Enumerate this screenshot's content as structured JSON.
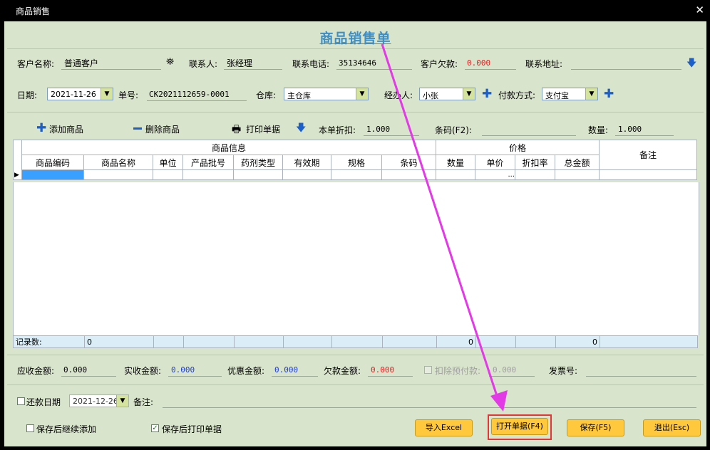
{
  "window": {
    "title": "商品销售",
    "close": "✕"
  },
  "heading": "商品销售单",
  "row1": {
    "customer_label": "客户名称:",
    "customer_value": "普通客户",
    "contact_label": "联系人:",
    "contact_value": "张经理",
    "phone_label": "联系电话:",
    "phone_value": "35134646",
    "debt_label": "客户欠款:",
    "debt_value": "0.000",
    "address_label": "联系地址:",
    "address_value": ""
  },
  "row2": {
    "date_label": "日期:",
    "date_value": "2021-11-26",
    "no_label": "单号:",
    "no_value": "CK2021112659-0001",
    "warehouse_label": "仓库:",
    "warehouse_value": "主仓库",
    "handler_label": "经办人:",
    "handler_value": "小张",
    "payment_label": "付款方式:",
    "payment_value": "支付宝"
  },
  "toolbar": {
    "add_label": "添加商品",
    "delete_label": "删除商品",
    "print_label": "打印单据",
    "discount_label": "本单折扣:",
    "discount_value": "1.000",
    "barcode_label": "条码(F2):",
    "barcode_value": "",
    "qty_label": "数量:",
    "qty_value": "1.000"
  },
  "grid": {
    "group1": "商品信息",
    "group2": "价格",
    "remark": "备注",
    "columns": [
      "商品编码",
      "商品名称",
      "单位",
      "产品批号",
      "药剂类型",
      "有效期",
      "规格",
      "条码",
      "数量",
      "单价",
      "折扣率",
      "总金额"
    ],
    "ellipsis": "...",
    "footer_label": "记录数:",
    "footer_count": "0",
    "footer_qty": "0",
    "footer_total": "0"
  },
  "totals": {
    "receivable_label": "应收金额:",
    "receivable_value": "0.000",
    "received_label": "实收金额:",
    "received_value": "0.000",
    "discount_label": "优惠金额:",
    "discount_value": "0.000",
    "owed_label": "欠款金额:",
    "owed_value": "0.000",
    "prepaid_label": "扣除预付款:",
    "prepaid_value": "0.000",
    "invoice_label": "发票号:",
    "invoice_value": ""
  },
  "repay": {
    "label": "还款日期",
    "date_value": "2021-12-26",
    "remark_label": "备注:",
    "remark_value": ""
  },
  "options": {
    "continue_label": "保存后继续添加",
    "print_label": "保存后打印单据"
  },
  "buttons": {
    "import": "导入Excel",
    "open": "打开单据(F4)",
    "save": "保存(F5)",
    "exit": "退出(Esc)"
  },
  "colors": {
    "accent": "#3f8fc4",
    "red_value": "#e02020",
    "blue_value": "#1f3fd0",
    "annotation": "#e23be6"
  }
}
